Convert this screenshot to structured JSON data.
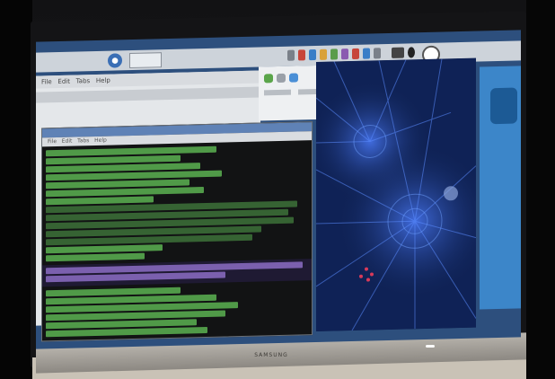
{
  "scene": {
    "description_type": "photo-of-monitor",
    "monitor_brand": "SAMSUNG"
  },
  "taskbar": {
    "menu_icon": "raspberry-menu-icon",
    "task_tab_label": "",
    "tray_icons": [
      "network-icon",
      "volume-icon",
      "cpu-icon",
      "clock-icon"
    ]
  },
  "background_window": {
    "menu_items": [
      "File",
      "Edit",
      "Tabs",
      "Help"
    ]
  },
  "terminal": {
    "menu_items": [
      "File",
      "Edit",
      "Tabs",
      "Help"
    ]
  },
  "colors": {
    "terminal_text": "#66c85a",
    "terminal_bg": "#121314",
    "viewer_bg": "#0e1f4a",
    "desktop": "#2d4f7d",
    "accent_panel": "#3c86c9"
  }
}
